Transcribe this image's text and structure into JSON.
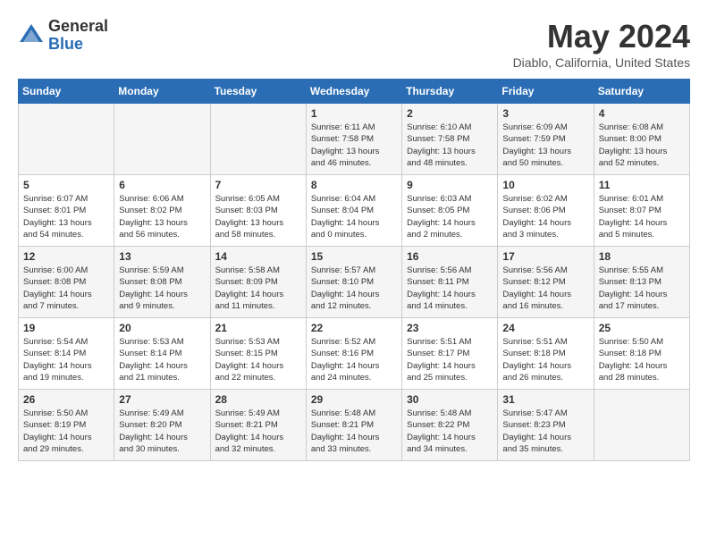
{
  "header": {
    "logo_general": "General",
    "logo_blue": "Blue",
    "month_year": "May 2024",
    "location": "Diablo, California, United States"
  },
  "days_of_week": [
    "Sunday",
    "Monday",
    "Tuesday",
    "Wednesday",
    "Thursday",
    "Friday",
    "Saturday"
  ],
  "weeks": [
    [
      {
        "day": "",
        "info": ""
      },
      {
        "day": "",
        "info": ""
      },
      {
        "day": "",
        "info": ""
      },
      {
        "day": "1",
        "info": "Sunrise: 6:11 AM\nSunset: 7:58 PM\nDaylight: 13 hours\nand 46 minutes."
      },
      {
        "day": "2",
        "info": "Sunrise: 6:10 AM\nSunset: 7:58 PM\nDaylight: 13 hours\nand 48 minutes."
      },
      {
        "day": "3",
        "info": "Sunrise: 6:09 AM\nSunset: 7:59 PM\nDaylight: 13 hours\nand 50 minutes."
      },
      {
        "day": "4",
        "info": "Sunrise: 6:08 AM\nSunset: 8:00 PM\nDaylight: 13 hours\nand 52 minutes."
      }
    ],
    [
      {
        "day": "5",
        "info": "Sunrise: 6:07 AM\nSunset: 8:01 PM\nDaylight: 13 hours\nand 54 minutes."
      },
      {
        "day": "6",
        "info": "Sunrise: 6:06 AM\nSunset: 8:02 PM\nDaylight: 13 hours\nand 56 minutes."
      },
      {
        "day": "7",
        "info": "Sunrise: 6:05 AM\nSunset: 8:03 PM\nDaylight: 13 hours\nand 58 minutes."
      },
      {
        "day": "8",
        "info": "Sunrise: 6:04 AM\nSunset: 8:04 PM\nDaylight: 14 hours\nand 0 minutes."
      },
      {
        "day": "9",
        "info": "Sunrise: 6:03 AM\nSunset: 8:05 PM\nDaylight: 14 hours\nand 2 minutes."
      },
      {
        "day": "10",
        "info": "Sunrise: 6:02 AM\nSunset: 8:06 PM\nDaylight: 14 hours\nand 3 minutes."
      },
      {
        "day": "11",
        "info": "Sunrise: 6:01 AM\nSunset: 8:07 PM\nDaylight: 14 hours\nand 5 minutes."
      }
    ],
    [
      {
        "day": "12",
        "info": "Sunrise: 6:00 AM\nSunset: 8:08 PM\nDaylight: 14 hours\nand 7 minutes."
      },
      {
        "day": "13",
        "info": "Sunrise: 5:59 AM\nSunset: 8:08 PM\nDaylight: 14 hours\nand 9 minutes."
      },
      {
        "day": "14",
        "info": "Sunrise: 5:58 AM\nSunset: 8:09 PM\nDaylight: 14 hours\nand 11 minutes."
      },
      {
        "day": "15",
        "info": "Sunrise: 5:57 AM\nSunset: 8:10 PM\nDaylight: 14 hours\nand 12 minutes."
      },
      {
        "day": "16",
        "info": "Sunrise: 5:56 AM\nSunset: 8:11 PM\nDaylight: 14 hours\nand 14 minutes."
      },
      {
        "day": "17",
        "info": "Sunrise: 5:56 AM\nSunset: 8:12 PM\nDaylight: 14 hours\nand 16 minutes."
      },
      {
        "day": "18",
        "info": "Sunrise: 5:55 AM\nSunset: 8:13 PM\nDaylight: 14 hours\nand 17 minutes."
      }
    ],
    [
      {
        "day": "19",
        "info": "Sunrise: 5:54 AM\nSunset: 8:14 PM\nDaylight: 14 hours\nand 19 minutes."
      },
      {
        "day": "20",
        "info": "Sunrise: 5:53 AM\nSunset: 8:14 PM\nDaylight: 14 hours\nand 21 minutes."
      },
      {
        "day": "21",
        "info": "Sunrise: 5:53 AM\nSunset: 8:15 PM\nDaylight: 14 hours\nand 22 minutes."
      },
      {
        "day": "22",
        "info": "Sunrise: 5:52 AM\nSunset: 8:16 PM\nDaylight: 14 hours\nand 24 minutes."
      },
      {
        "day": "23",
        "info": "Sunrise: 5:51 AM\nSunset: 8:17 PM\nDaylight: 14 hours\nand 25 minutes."
      },
      {
        "day": "24",
        "info": "Sunrise: 5:51 AM\nSunset: 8:18 PM\nDaylight: 14 hours\nand 26 minutes."
      },
      {
        "day": "25",
        "info": "Sunrise: 5:50 AM\nSunset: 8:18 PM\nDaylight: 14 hours\nand 28 minutes."
      }
    ],
    [
      {
        "day": "26",
        "info": "Sunrise: 5:50 AM\nSunset: 8:19 PM\nDaylight: 14 hours\nand 29 minutes."
      },
      {
        "day": "27",
        "info": "Sunrise: 5:49 AM\nSunset: 8:20 PM\nDaylight: 14 hours\nand 30 minutes."
      },
      {
        "day": "28",
        "info": "Sunrise: 5:49 AM\nSunset: 8:21 PM\nDaylight: 14 hours\nand 32 minutes."
      },
      {
        "day": "29",
        "info": "Sunrise: 5:48 AM\nSunset: 8:21 PM\nDaylight: 14 hours\nand 33 minutes."
      },
      {
        "day": "30",
        "info": "Sunrise: 5:48 AM\nSunset: 8:22 PM\nDaylight: 14 hours\nand 34 minutes."
      },
      {
        "day": "31",
        "info": "Sunrise: 5:47 AM\nSunset: 8:23 PM\nDaylight: 14 hours\nand 35 minutes."
      },
      {
        "day": "",
        "info": ""
      }
    ]
  ]
}
